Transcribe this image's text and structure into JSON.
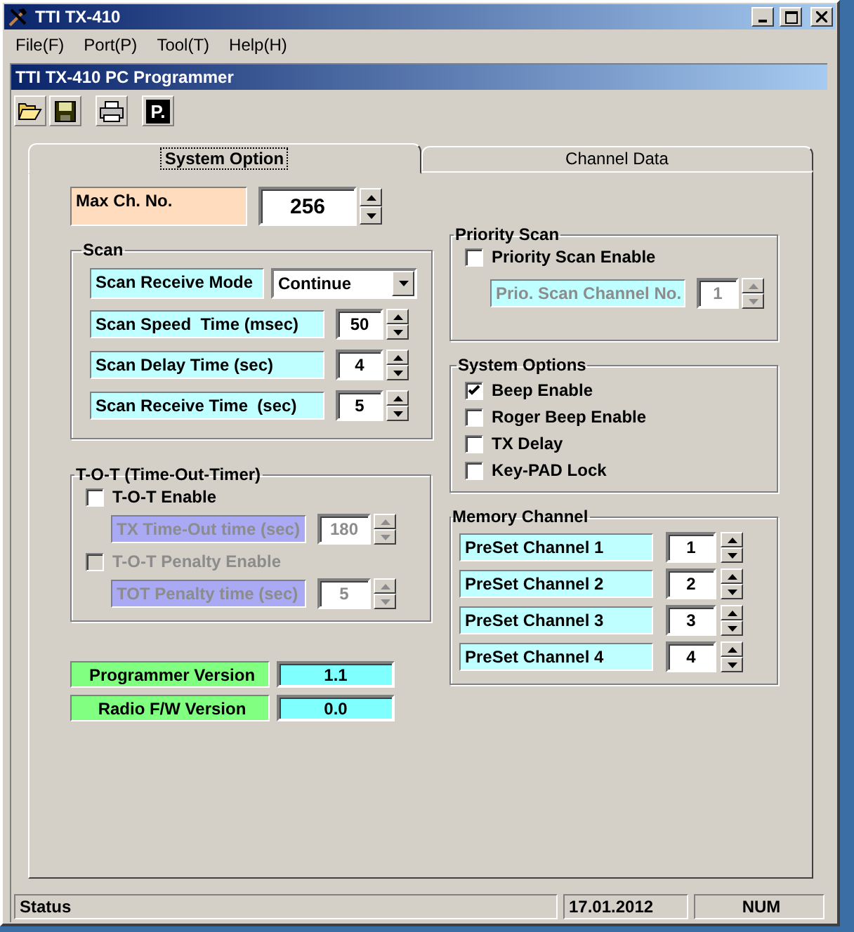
{
  "window": {
    "title": "TTI TX-410"
  },
  "menu": [
    "File(F)",
    "Port(P)",
    "Tool(T)",
    "Help(H)"
  ],
  "child_window": {
    "title": "TTI TX-410 PC Programmer"
  },
  "toolbar": {
    "p_button_label": "P."
  },
  "tabs": [
    {
      "label": "System Option",
      "selected": true
    },
    {
      "label": "Channel Data",
      "selected": false
    }
  ],
  "max_channel": {
    "label": "Max Ch. No.",
    "value": "256"
  },
  "scan": {
    "title": "Scan",
    "rows": [
      {
        "kind": "dropdown",
        "label": "Scan Receive Mode",
        "value": "Continue"
      },
      {
        "kind": "spinner",
        "label": "Scan Speed  Time (msec)",
        "value": "50"
      },
      {
        "kind": "spinner",
        "label": "Scan Delay Time (sec)",
        "value": "4"
      },
      {
        "kind": "spinner",
        "label": "Scan Receive Time  (sec)",
        "value": "5"
      }
    ]
  },
  "tot": {
    "title": "T-O-T (Time-Out-Timer)",
    "items": [
      {
        "kind": "checkbox",
        "label": "T-O-T Enable",
        "checked": false,
        "disabled": false
      },
      {
        "kind": "spinner",
        "label": "TX Time-Out time (sec)",
        "value": "180",
        "disabled": true,
        "color": "#aaaaf4"
      },
      {
        "kind": "checkbox",
        "label": "T-O-T Penalty Enable",
        "checked": false,
        "disabled": true
      },
      {
        "kind": "spinner",
        "label": "TOT Penalty time (sec)",
        "value": "5",
        "disabled": true,
        "color": "#aaaaf4"
      }
    ]
  },
  "versions": [
    {
      "label": "Programmer Version",
      "value": "1.1"
    },
    {
      "label": "Radio F/W Version",
      "value": "0.0"
    }
  ],
  "priority_scan": {
    "title": "Priority Scan",
    "items": [
      {
        "kind": "checkbox",
        "label": "Priority Scan Enable",
        "checked": false,
        "disabled": false
      },
      {
        "kind": "spinner",
        "label": "Prio. Scan Channel No.",
        "value": "1",
        "disabled": true,
        "color": "#c0ffff"
      }
    ]
  },
  "system_options": {
    "title": "System Options",
    "options": [
      {
        "label": "Beep Enable",
        "checked": true
      },
      {
        "label": "Roger Beep Enable",
        "checked": false
      },
      {
        "label": "TX Delay",
        "checked": false
      },
      {
        "label": "Key-PAD Lock",
        "checked": false
      }
    ]
  },
  "memory_channel": {
    "title": "Memory Channel",
    "rows": [
      {
        "label": "PreSet Channel 1",
        "value": "1"
      },
      {
        "label": "PreSet Channel 2",
        "value": "2"
      },
      {
        "label": "PreSet Channel 3",
        "value": "3"
      },
      {
        "label": "PreSet Channel 4",
        "value": "4"
      }
    ]
  },
  "status_bar": [
    "Status",
    "17.01.2012",
    "NUM"
  ]
}
